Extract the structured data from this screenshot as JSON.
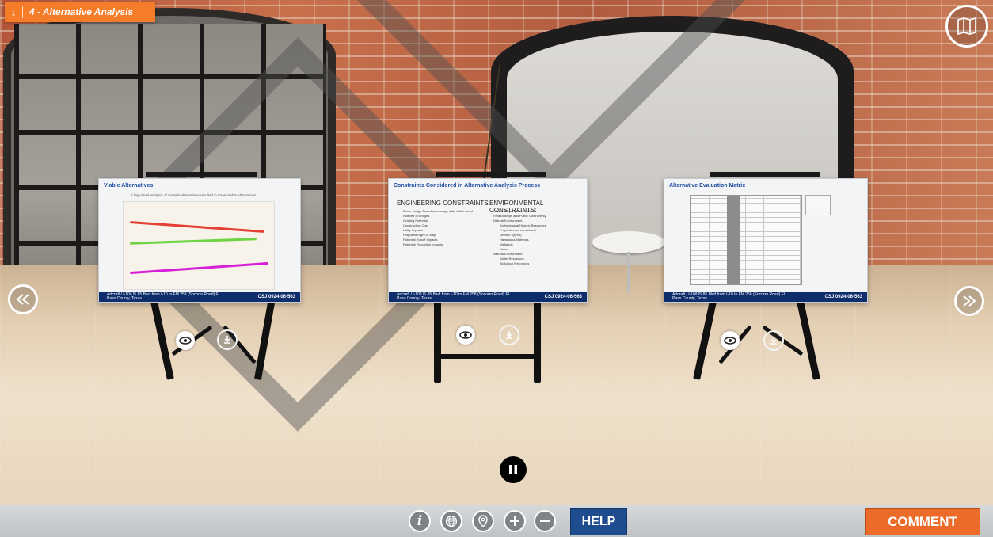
{
  "section_tab": {
    "label": "4 - Alternative Analysis"
  },
  "boards": [
    {
      "title": "Viable Alternatives",
      "subtitle": "A high-level analysis of multiple alternatives resulted in three Viable Alternatives.",
      "footer_left": "Artcraft / I-10/US 85 Blvd from I-10 to FM 258 (Socorro Road) El Paso County, Texas",
      "footer_right": "CSJ 0924-06-563"
    },
    {
      "title": "Constraints Considered in Alternative Analysis Process",
      "eng_heading": "ENGINEERING CONSTRAINTS:",
      "env_heading": "ENVIRONMENTAL CONSTRAINTS:",
      "eng_items": [
        "Driver Usage Based on average daily traffic count",
        "Number of Bridges",
        "Grading Potential",
        "Construction Cost",
        "Utility Impacts",
        "Proposed Right of Way",
        "Potential Runoff Impacts",
        "Potential Floodplain Impacts"
      ],
      "env_items": [
        "Private Property and Rural",
        "Relationships and Public Controversy",
        "Natural Environment",
        "Archeological/Historic Resources",
        "Properties not considered",
        "Section 4(f)/6(f)",
        "Hazardous Materials",
        "Wetlands",
        "Noise",
        "Natural Environment",
        "Water Resources",
        "Biological Resources"
      ],
      "footer_left": "Artcraft / I-10/US 85 Blvd from I-10 to FM 258 (Socorro Road) El Paso County, Texas",
      "footer_right": "CSJ 0924-06-563"
    },
    {
      "title": "Alternative Evaluation Matrix",
      "footer_left": "Artcraft / I-10/US 85 Blvd from I-10 to FM 258 (Socorro Road) El Paso County, Texas",
      "footer_right": "CSJ 0924-06-563"
    }
  ],
  "bottom_bar": {
    "info_label": "i",
    "help_label": "HELP",
    "comment_label": "COMMENT"
  },
  "icons": [
    "arrow-down-icon",
    "map-icon",
    "eye-icon",
    "download-icon",
    "rewind-icon",
    "fast-forward-icon",
    "pause-icon",
    "info-icon",
    "globe-icon",
    "location-pin-icon",
    "plus-icon",
    "minus-icon"
  ]
}
